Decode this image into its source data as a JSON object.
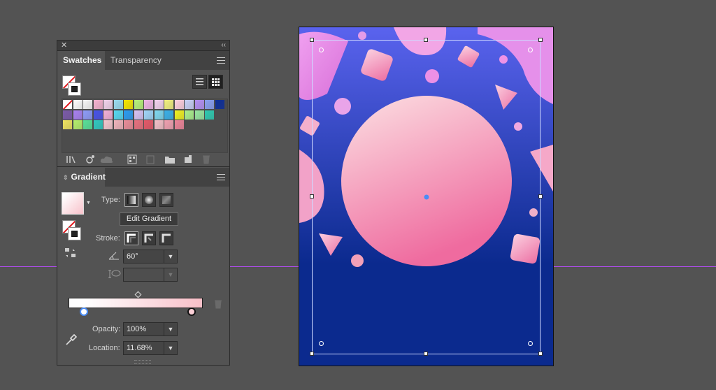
{
  "panel": {
    "close_glyph": "✕",
    "collapse_glyph": "‹‹",
    "swatches_tab": "Swatches",
    "transparency_tab": "Transparency",
    "swatch_colors": [
      [
        "none",
        "#ffffff",
        "#f7f7f7",
        "#f5b3d0",
        "#f2d3ec",
        "#9bdcf0",
        "#f5e600",
        "#b7f27a",
        "#f0b4e6",
        "#f4d2f0",
        "#f2f080",
        "#ffd0e0",
        "#c8d0f7",
        "#b490f3",
        "#8a9ff0",
        "#0d2d97"
      ],
      [
        "#7a5aa8",
        "#a880f0",
        "#8d9bf8",
        "#4752e8",
        "#f4b0d8",
        "#56d8f0",
        "#2a9bf0",
        "#d8c2f4",
        "#a0d4f8",
        "#7fd8f0",
        "#3ab0e8",
        "#f0f020",
        "#aaf08c",
        "#98e6a0",
        "#2ec9b0",
        ""
      ],
      [
        "#f0e460",
        "#b4f06c",
        "#58e098",
        "#30c8c0",
        "#f6c8d0",
        "#f0b4bc",
        "#ea8c98",
        "#e8707e",
        "#e45868",
        "#f4c0c8",
        "#f0a0b0",
        "#ec8498",
        "",
        "",
        "",
        ""
      ]
    ],
    "gradient_tab": "Gradient",
    "type_label": "Type:",
    "tooltip": "Edit Gradient",
    "stroke_label": "Stroke:",
    "angle_value": "60°",
    "opacity_label": "Opacity:",
    "opacity_value": "100%",
    "location_label": "Location:",
    "location_value": "11.68%"
  },
  "icons": {
    "library": "library-icon",
    "swatch_kind": "swatch-kind-icon",
    "cloud": "cloud-icon",
    "show_options": "swatch-options-icon",
    "color_group": "color-group-icon",
    "folder": "folder-icon",
    "new_swatch": "new-swatch-icon",
    "trash": "trash-icon",
    "eyedropper": "eyedropper-icon",
    "angle": "angle-icon",
    "aspect": "aspect-ratio-icon"
  },
  "colors": {
    "guide": "#b04cf0",
    "artboard_bg_top": "#5a63ee",
    "artboard_bg_bottom": "#0b2a8e",
    "sun_top": "#fce1e3",
    "sun_bottom": "#ef6b9f",
    "selection": "#4a8cf5"
  }
}
